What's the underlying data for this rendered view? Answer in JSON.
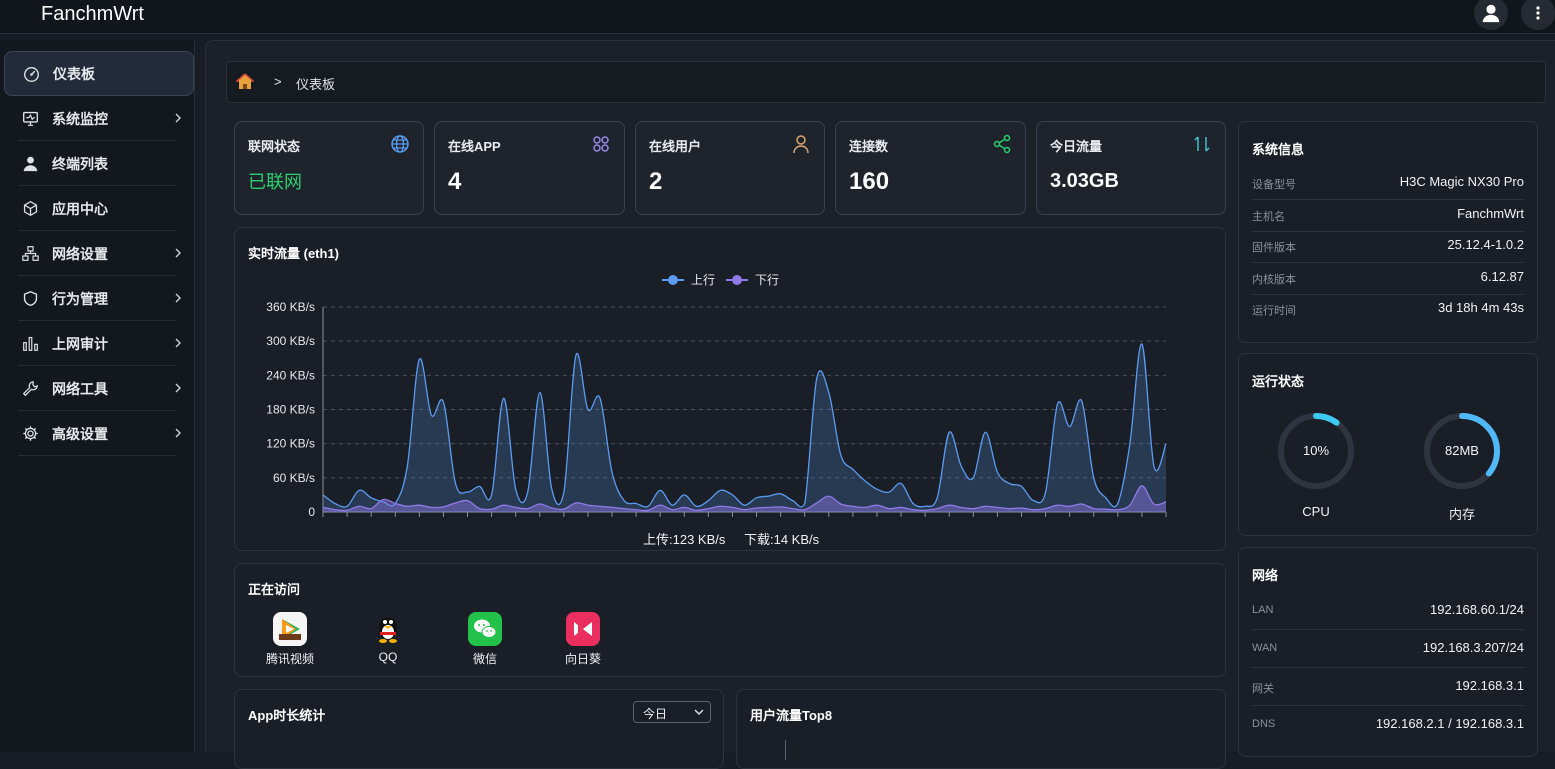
{
  "app": {
    "title": "FanchmWrt"
  },
  "header": {
    "user_icon": "user-icon",
    "menu_icon": "more-vertical-icon"
  },
  "sidebar": {
    "items": [
      {
        "label": "仪表板",
        "icon": "dashboard-icon",
        "active": true,
        "has_children": false
      },
      {
        "label": "系统监控",
        "icon": "monitor-icon",
        "has_children": true
      },
      {
        "label": "终端列表",
        "icon": "user-icon",
        "has_children": false
      },
      {
        "label": "应用中心",
        "icon": "cube-icon",
        "has_children": false
      },
      {
        "label": "网络设置",
        "icon": "network-icon",
        "has_children": true
      },
      {
        "label": "行为管理",
        "icon": "shield-icon",
        "has_children": true
      },
      {
        "label": "上网审计",
        "icon": "bar-chart-icon",
        "has_children": true
      },
      {
        "label": "网络工具",
        "icon": "wrench-icon",
        "has_children": true
      },
      {
        "label": "高级设置",
        "icon": "gear-icon",
        "has_children": true
      }
    ]
  },
  "breadcrumb": {
    "home_icon": "home-icon",
    "separator": ">",
    "current": "仪表板"
  },
  "stats": [
    {
      "title": "联网状态",
      "value": "已联网",
      "icon": "globe-icon",
      "color": "#2ccf6e"
    },
    {
      "title": "在线APP",
      "value": "4",
      "icon": "apps-icon"
    },
    {
      "title": "在线用户",
      "value": "2",
      "icon": "person-icon"
    },
    {
      "title": "连接数",
      "value": "160",
      "icon": "share-icon"
    },
    {
      "title": "今日流量",
      "value": "3.03GB",
      "icon": "updown-arrows-icon"
    }
  ],
  "traffic": {
    "title": "实时流量 (eth1)",
    "footer_up": "上传:123 KB/s",
    "footer_down": "下载:14 KB/s"
  },
  "chart_data": {
    "type": "area",
    "title": "实时流量 (eth1)",
    "yunit": "KB/s",
    "ylim": [
      0,
      360
    ],
    "yticks": [
      "0",
      "60 KB/s",
      "120 KB/s",
      "180 KB/s",
      "240 KB/s",
      "300 KB/s",
      "360 KB/s"
    ],
    "grid": true,
    "legend_position": "top-center",
    "series": [
      {
        "name": "上行",
        "color": "#5b9bf0",
        "values": [
          30,
          15,
          10,
          38,
          25,
          18,
          15,
          80,
          268,
          170,
          193,
          50,
          35,
          45,
          30,
          200,
          40,
          35,
          210,
          40,
          35,
          275,
          180,
          200,
          70,
          20,
          15,
          10,
          38,
          12,
          30,
          10,
          20,
          38,
          30,
          12,
          25,
          28,
          32,
          20,
          15,
          235,
          210,
          100,
          75,
          55,
          40,
          35,
          50,
          15,
          10,
          25,
          140,
          80,
          60,
          140,
          70,
          50,
          45,
          20,
          35,
          190,
          150,
          195,
          60,
          25,
          15,
          120,
          295,
          80,
          120
        ]
      },
      {
        "name": "下行",
        "color": "#8f7ae8",
        "values": [
          8,
          4,
          3,
          10,
          6,
          22,
          15,
          10,
          12,
          8,
          9,
          16,
          20,
          6,
          5,
          12,
          8,
          6,
          14,
          7,
          5,
          16,
          12,
          10,
          8,
          6,
          4,
          3,
          12,
          4,
          8,
          3,
          6,
          10,
          8,
          4,
          7,
          8,
          9,
          6,
          4,
          16,
          28,
          14,
          10,
          8,
          12,
          6,
          8,
          4,
          3,
          6,
          12,
          8,
          6,
          10,
          8,
          6,
          7,
          4,
          6,
          12,
          10,
          14,
          6,
          5,
          4,
          12,
          46,
          14,
          18
        ]
      }
    ]
  },
  "visiting": {
    "title": "正在访问",
    "apps": [
      {
        "name": "腾讯视频",
        "icon": "tencent-video-icon"
      },
      {
        "name": "QQ",
        "icon": "qq-penguin-icon"
      },
      {
        "name": "微信",
        "icon": "wechat-icon"
      },
      {
        "name": "向日葵",
        "icon": "sunflower-icon"
      }
    ]
  },
  "app_duration": {
    "title": "App时长统计",
    "period": "今日"
  },
  "user_top": {
    "title": "用户流量Top8"
  },
  "sysinfo": {
    "title": "系统信息",
    "rows": [
      {
        "k": "设备型号",
        "v": "H3C Magic NX30 Pro"
      },
      {
        "k": "主机名",
        "v": "FanchmWrt"
      },
      {
        "k": "固件版本",
        "v": "25.12.4-1.0.2"
      },
      {
        "k": "内核版本",
        "v": "6.12.87"
      },
      {
        "k": "运行时间",
        "v": "3d 18h 4m 43s"
      }
    ]
  },
  "runstate": {
    "title": "运行状态",
    "cpu": {
      "text": "10%",
      "label": "CPU",
      "fraction": 0.1,
      "color": "#3ec9f0"
    },
    "mem": {
      "text": "82MB",
      "label": "内存",
      "fraction": 0.36,
      "color": "#4fb8f5"
    }
  },
  "network": {
    "title": "网络",
    "rows": [
      {
        "k": "LAN",
        "v": "192.168.60.1/24"
      },
      {
        "k": "WAN",
        "v": "192.168.3.207/24"
      },
      {
        "k": "网关",
        "v": "192.168.3.1"
      },
      {
        "k": "DNS",
        "v": "192.168.2.1 / 192.168.3.1"
      }
    ]
  }
}
